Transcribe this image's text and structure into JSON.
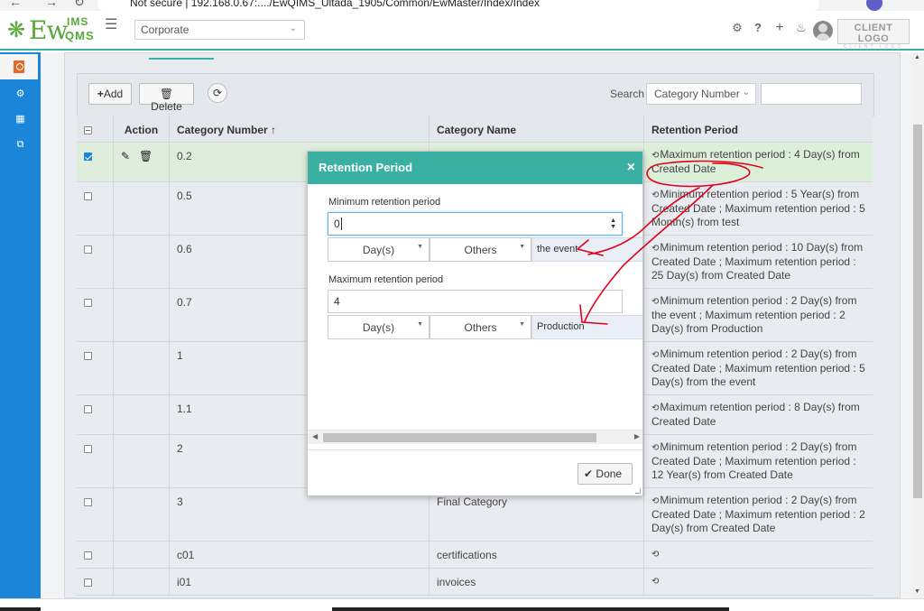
{
  "browser": {
    "url_site": "Not secure",
    "url_path": "",
    "url_display": "Not secure  |  192.168.0.67:..../EwQIMS_Ultada_1905/Common/EwMaster/Index/Index"
  },
  "header": {
    "org_select": "Corporate",
    "client_logo_title": "CLIENT LOGO",
    "client_logo_sub": "CLIENT LOGO"
  },
  "toolbar": {
    "add_label": "Add",
    "delete_label": "Delete",
    "search_label": "Search",
    "search_field": "Category Number"
  },
  "table": {
    "columns": [
      "Action",
      "Category Number",
      "Category Name",
      "Retention Period"
    ],
    "sort_indicator": "↑",
    "rows": [
      {
        "number": "0.2",
        "name": "",
        "retention": "Maximum retention period : 4 Day(s) from Created Date",
        "checked": true
      },
      {
        "number": "0.5",
        "name": "",
        "retention": "Minimum retention period : 5 Year(s) from Created Date ; Maximum retention period : 5 Month(s) from test",
        "checked": false
      },
      {
        "number": "0.6",
        "name": "",
        "retention": "Minimum retention period : 10 Day(s) from Created Date ; Maximum retention period : 25 Day(s) from Created Date",
        "checked": false
      },
      {
        "number": "0.7",
        "name": "",
        "retention": "Minimum retention period : 2 Day(s) from the event ; Maximum retention period : 2 Day(s) from Production",
        "checked": false
      },
      {
        "number": "1",
        "name": "",
        "retention": "Minimum retention period : 2 Day(s) from Created Date ; Maximum retention period : 5 Day(s) from the event",
        "checked": false
      },
      {
        "number": "1.1",
        "name": "",
        "retention": "Maximum retention period : 8 Day(s) from Created Date",
        "checked": false
      },
      {
        "number": "2",
        "name": "",
        "retention": "Minimum retention period : 2 Day(s) from Created Date ; Maximum retention period : 12 Year(s) from Created Date",
        "checked": false
      },
      {
        "number": "3",
        "name": "Final Category",
        "retention": "Minimum retention period : 2 Day(s) from Created Date ; Maximum retention period : 2 Day(s) from Created Date",
        "checked": false
      },
      {
        "number": "c01",
        "name": "certifications",
        "retention": "",
        "checked": false
      },
      {
        "number": "i01",
        "name": "invoices",
        "retention": "",
        "checked": false
      }
    ]
  },
  "modal": {
    "title": "Retention Period",
    "close": "×",
    "min_label": "Minimum retention period",
    "min_value": "0",
    "min_unit": "Day(s)",
    "min_from": "Others",
    "min_ref": "the event",
    "max_label": "Maximum retention period",
    "max_value": "4",
    "max_unit": "Day(s)",
    "max_from": "Others",
    "max_ref": "Production",
    "done_label": "Done"
  },
  "colors": {
    "accent": "#3ab0a3",
    "sidebar": "#1a85d9",
    "annotation": "#e0001a"
  }
}
